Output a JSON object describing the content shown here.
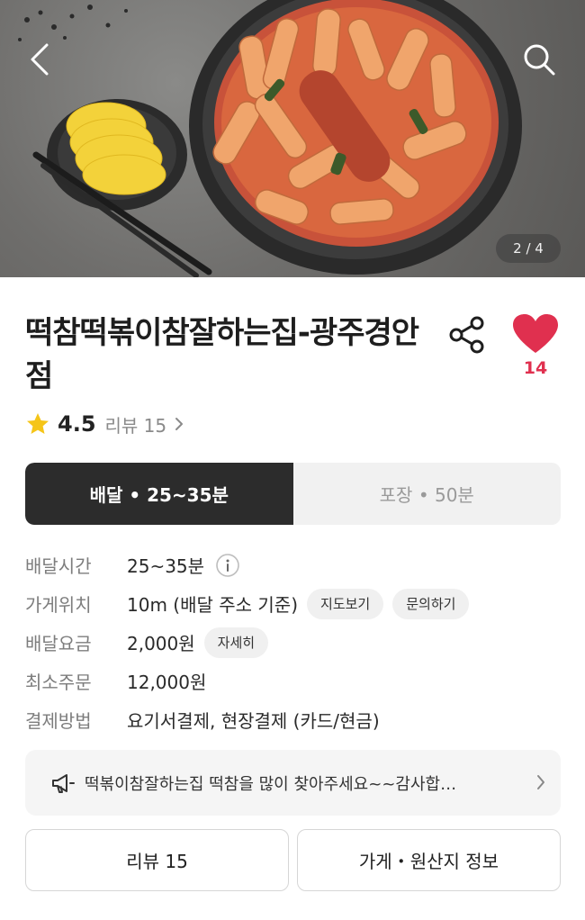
{
  "hero": {
    "image_counter": "2 / 4",
    "back_icon": "chevron-left-icon",
    "search_icon": "search-icon"
  },
  "store": {
    "name": "떡참떡볶이참잘하는집-광주경안점",
    "like_count": "14",
    "rating": "4.5",
    "review_link": "리뷰 15"
  },
  "order_type": {
    "delivery": "배달 • 25~35분",
    "pickup": "포장 • 50분",
    "selected": "delivery"
  },
  "details": [
    {
      "label": "배달시간",
      "value": "25~35분"
    },
    {
      "label": "가게위치",
      "value": "10m (배달 주소 기준)",
      "chips": [
        "지도보기",
        "문의하기"
      ]
    },
    {
      "label": "배달요금",
      "value": "2,000원",
      "chips": [
        "자세히"
      ]
    },
    {
      "label": "최소주문",
      "value": "12,000원"
    },
    {
      "label": "결제방법",
      "value": "요기서결제, 현장결제 (카드/현금)"
    }
  ],
  "notice": {
    "text": "떡볶이참잘하는집  떡참을 많이 찾아주세요~~감사합…"
  },
  "buttons": {
    "reviews": "리뷰 15",
    "store_info": "가게・원산지 정보"
  },
  "colors": {
    "accent": "#e0304f",
    "active_segment": "#2c2c2c",
    "star": "#f5c518"
  }
}
